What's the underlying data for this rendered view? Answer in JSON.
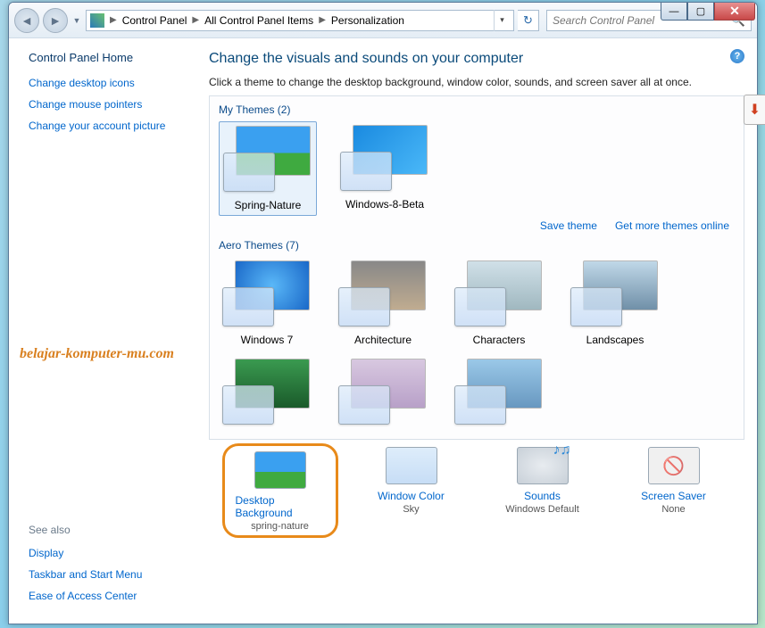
{
  "breadcrumb": {
    "a": "Control Panel",
    "b": "All Control Panel Items",
    "c": "Personalization"
  },
  "search": {
    "placeholder": "Search Control Panel"
  },
  "sidebar": {
    "home": "Control Panel Home",
    "links": [
      "Change desktop icons",
      "Change mouse pointers",
      "Change your account picture"
    ],
    "see_also_head": "See also",
    "see_also": [
      "Display",
      "Taskbar and Start Menu",
      "Ease of Access Center"
    ]
  },
  "watermark": "belajar-komputer-mu.com",
  "main": {
    "title": "Change the visuals and sounds on your computer",
    "desc": "Click a theme to change the desktop background, window color, sounds, and screen saver all at once.",
    "section1": "My Themes (2)",
    "my_themes": [
      "Spring-Nature",
      "Windows-8-Beta"
    ],
    "save_theme": "Save theme",
    "get_more": "Get more themes online",
    "section2": "Aero Themes (7)",
    "aero_themes": [
      "Windows 7",
      "Architecture",
      "Characters",
      "Landscapes"
    ]
  },
  "bottom": {
    "items": [
      {
        "title": "Desktop Background",
        "sub": "spring-nature"
      },
      {
        "title": "Window Color",
        "sub": "Sky"
      },
      {
        "title": "Sounds",
        "sub": "Windows Default"
      },
      {
        "title": "Screen Saver",
        "sub": "None"
      }
    ]
  }
}
